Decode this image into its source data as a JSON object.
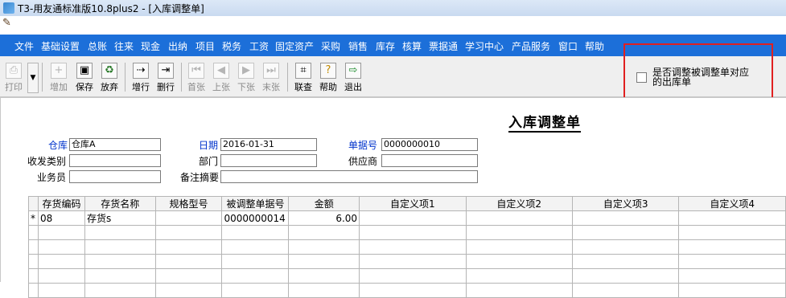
{
  "window": {
    "title": "T3-用友通标准版10.8plus2 - [入库调整单]"
  },
  "menu": [
    "文件",
    "基础设置",
    "总账",
    "往来",
    "现金",
    "出纳",
    "项目",
    "税务",
    "工资",
    "固定资产",
    "采购",
    "销售",
    "库存",
    "核算",
    "票据通",
    "学习中心",
    "产品服务",
    "窗口",
    "帮助"
  ],
  "toolbar": {
    "print": "打印",
    "add": "增加",
    "save": "保存",
    "discard": "放弃",
    "add_row": "增行",
    "delete_row": "删行",
    "first": "首张",
    "prev": "上张",
    "next": "下张",
    "last": "末张",
    "link_query": "联查",
    "help": "帮助",
    "exit": "退出"
  },
  "option": {
    "label": "是否调整被调整单对应的出库单",
    "checked": false
  },
  "form": {
    "title": "入库调整单",
    "warehouse_label": "仓库",
    "warehouse_value": "仓库A",
    "date_label": "日期",
    "date_value": "2016-01-31",
    "doc_no_label": "单据号",
    "doc_no_value": "0000000010",
    "category_label": "收发类别",
    "category_value": "",
    "dept_label": "部门",
    "dept_value": "",
    "supplier_label": "供应商",
    "supplier_value": "",
    "clerk_label": "业务员",
    "clerk_value": "",
    "remark_label": "备注摘要",
    "remark_value": ""
  },
  "grid": {
    "columns": [
      "存货编码",
      "存货名称",
      "规格型号",
      "被调整单据号",
      "金额",
      "自定义项1",
      "自定义项2",
      "自定义项3",
      "自定义项4"
    ],
    "rows": [
      {
        "marker": "*",
        "cells": [
          "08",
          "存货s",
          "",
          "0000000014",
          "6.00",
          "",
          "",
          "",
          ""
        ]
      }
    ]
  }
}
